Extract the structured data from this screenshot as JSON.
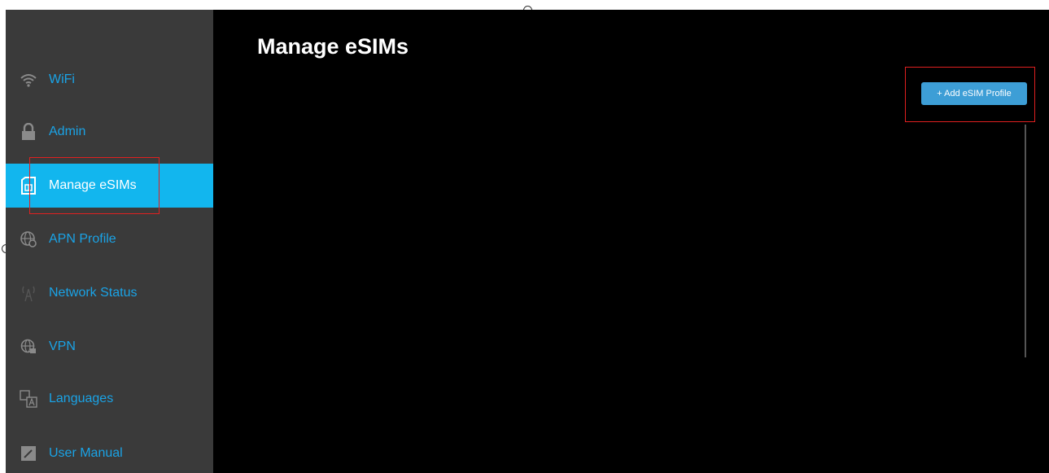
{
  "page": {
    "title": "Manage eSIMs"
  },
  "sidebar": {
    "items": [
      {
        "label": "WiFi",
        "icon": "wifi-icon",
        "active": false
      },
      {
        "label": "Admin",
        "icon": "lock-icon",
        "active": false
      },
      {
        "label": "Manage eSIMs",
        "icon": "sim-card-icon",
        "active": true
      },
      {
        "label": "APN Profile",
        "icon": "globe-gear-icon",
        "active": false
      },
      {
        "label": "Network Status",
        "icon": "signal-tower-icon",
        "active": false
      },
      {
        "label": "VPN",
        "icon": "globe-lock-icon",
        "active": false
      },
      {
        "label": "Languages",
        "icon": "translate-icon",
        "active": false
      },
      {
        "label": "User Manual",
        "icon": "manual-icon",
        "active": false
      }
    ]
  },
  "toolbar": {
    "add_profile_label": "+ Add eSIM Profile"
  },
  "colors": {
    "accent": "#12b6ee",
    "link": "#1aa3e6",
    "button": "#3d9ed6",
    "highlight": "#e02020",
    "sidebar_bg": "#3a3a3a",
    "main_bg": "#000000"
  }
}
